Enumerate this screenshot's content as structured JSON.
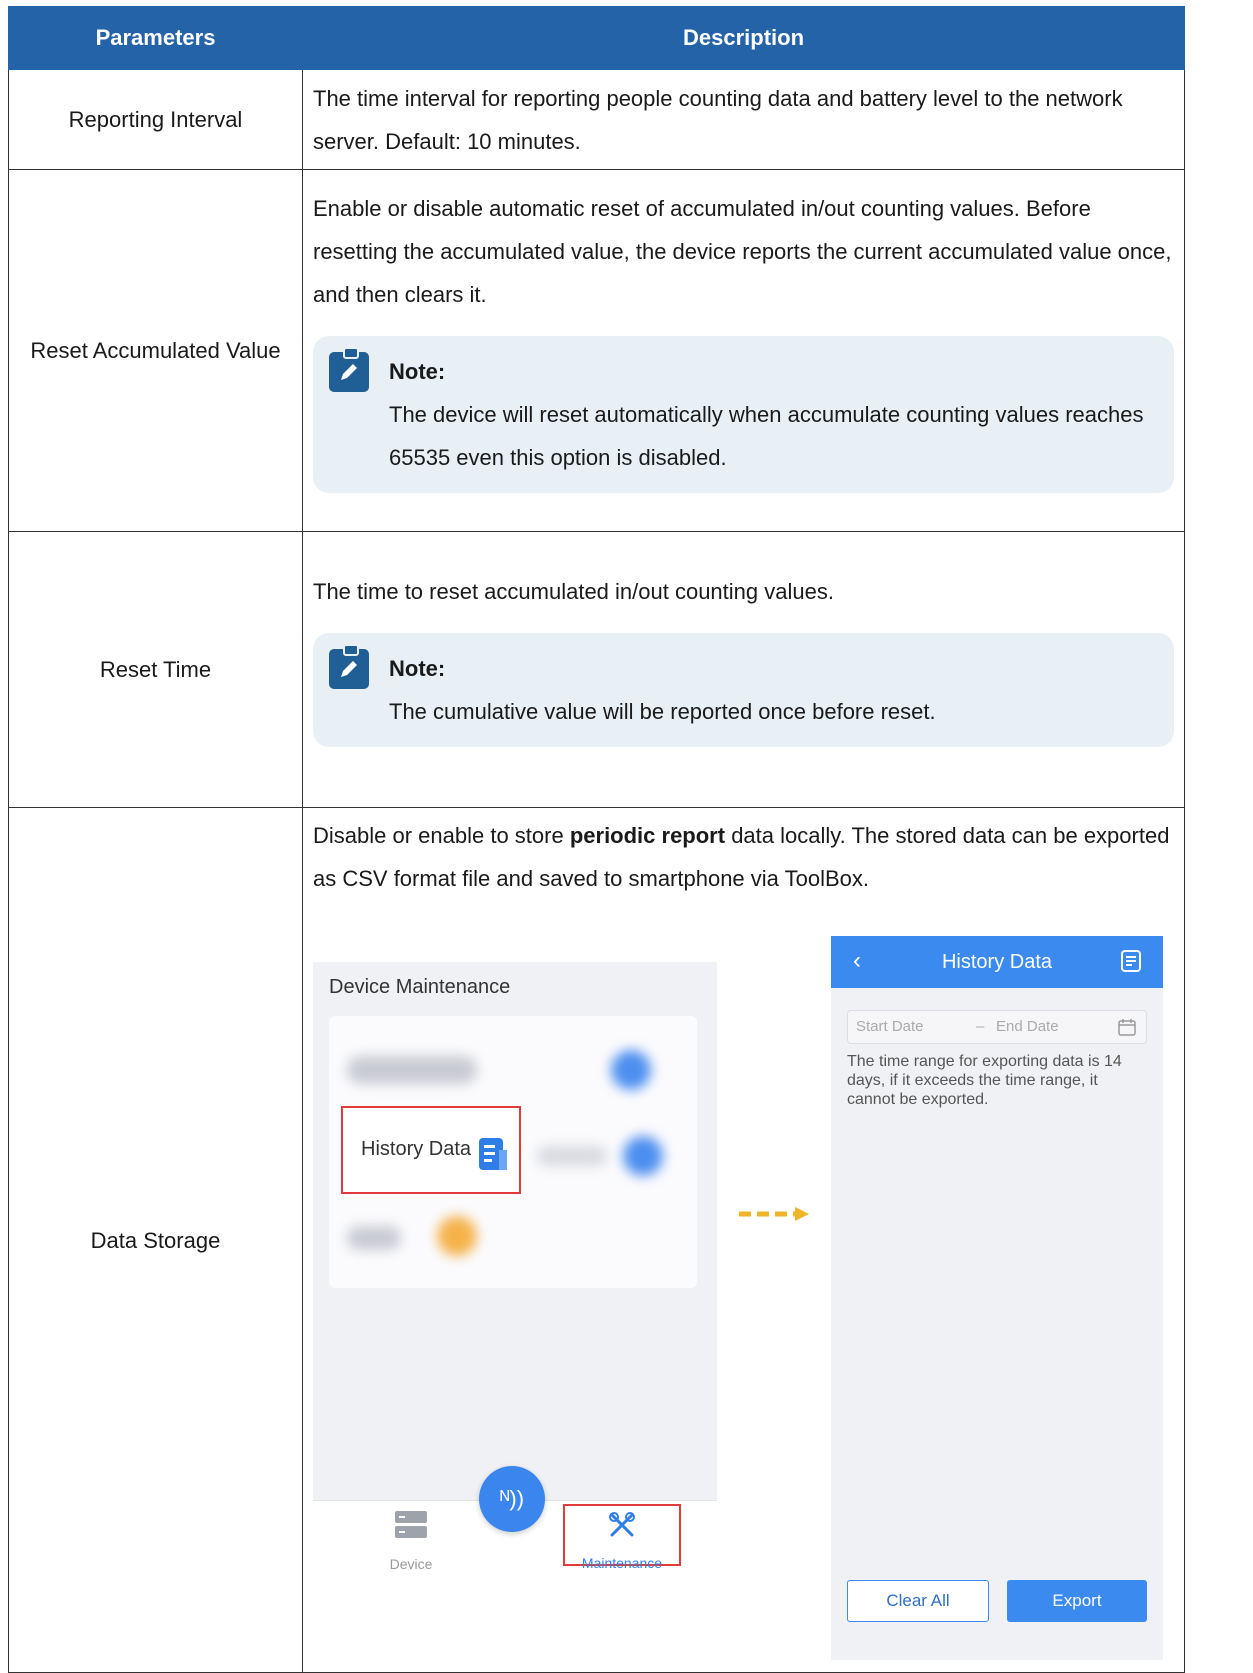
{
  "table": {
    "headers": {
      "parameters": "Parameters",
      "description": "Description"
    },
    "rows": {
      "reporting_interval": {
        "name": "Reporting Interval",
        "description": "The time interval for reporting people counting data and battery level to the network server. Default: 10 minutes."
      },
      "reset_accumulated": {
        "name": "Reset Accumulated Value",
        "description": "Enable or disable automatic reset of accumulated in/out counting values. Before resetting the accumulated value, the device reports the current accumulated value once, and then clears it.",
        "note_title": "Note:",
        "note_text": "The device will reset automatically when accumulate counting values reaches 65535 even this option is disabled."
      },
      "reset_time": {
        "name": "Reset Time",
        "description": "The time to reset accumulated in/out counting values.",
        "note_title": "Note:",
        "note_text": "The cumulative value will be reported once before reset."
      },
      "data_storage": {
        "name": "Data Storage",
        "desc_before": "Disable or enable to store ",
        "desc_bold": "periodic report",
        "desc_after": " data locally. The stored data can be exported as CSV format file and saved to smartphone via ToolBox."
      }
    }
  },
  "screenshot_maintenance": {
    "title": "Device Maintenance",
    "history_label": "History Data",
    "tab_device": "Device",
    "tab_maintenance": "Maintenance",
    "nfc_symbol": "ᴺ))"
  },
  "screenshot_history": {
    "header_title": "History Data",
    "back_symbol": "‹",
    "start_date_placeholder": "Start Date",
    "dash": "–",
    "end_date_placeholder": "End Date",
    "range_info": "The time range for exporting data is 14 days, if it exceeds the time range, it cannot be exported.",
    "clear_button": "Clear All",
    "export_button": "Export"
  },
  "colors": {
    "header_bg": "#2563a8",
    "note_bg": "#e8f0f5",
    "app_blue": "#3b8af0",
    "highlight_red": "#e23b3b",
    "arrow_gold": "#f0b429"
  }
}
